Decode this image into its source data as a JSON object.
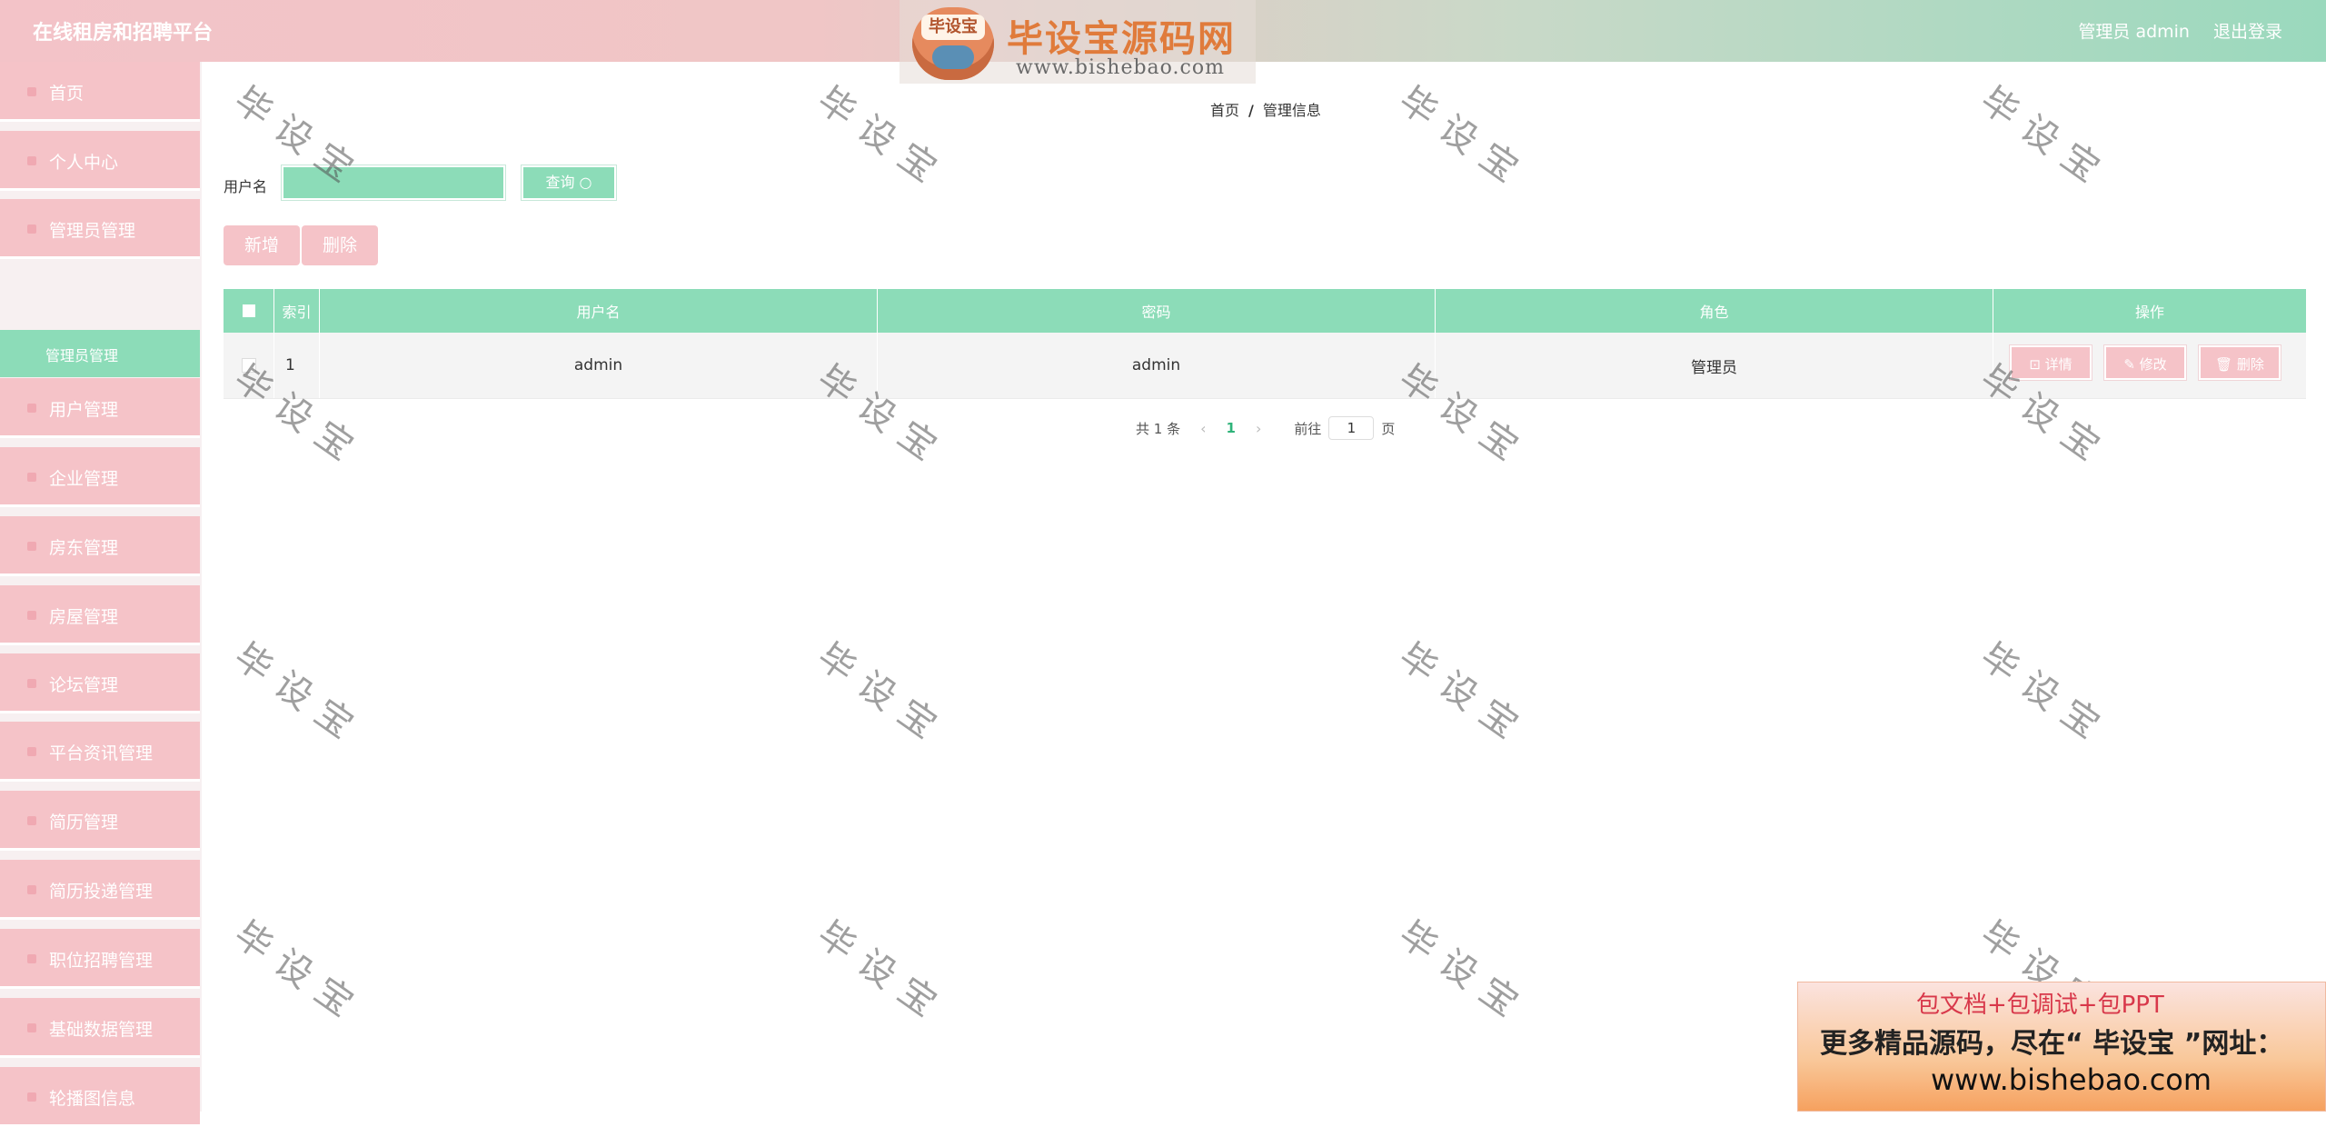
{
  "header": {
    "app_title": "在线租房和招聘平台",
    "user_label": "管理员 admin",
    "logout_label": "退出登录"
  },
  "logo": {
    "badge_text": "毕设宝",
    "main_text": "毕设宝源码网",
    "url_text": "www.bishebao.com"
  },
  "sidebar": {
    "items": [
      {
        "label": "首页"
      },
      {
        "label": "个人中心"
      },
      {
        "label": "管理员管理"
      },
      {
        "label": "用户管理"
      },
      {
        "label": "企业管理"
      },
      {
        "label": "房东管理"
      },
      {
        "label": "房屋管理"
      },
      {
        "label": "论坛管理"
      },
      {
        "label": "平台资讯管理"
      },
      {
        "label": "简历管理"
      },
      {
        "label": "简历投递管理"
      },
      {
        "label": "职位招聘管理"
      },
      {
        "label": "基础数据管理"
      },
      {
        "label": "轮播图信息"
      }
    ],
    "active_submenu": "管理员管理"
  },
  "breadcrumb": {
    "home": "首页",
    "separator": "/",
    "current": "管理信息"
  },
  "search": {
    "label": "用户名",
    "value": "",
    "query_button": "查询 ○"
  },
  "actions": {
    "add": "新增",
    "delete": "删除"
  },
  "table": {
    "columns": [
      "索引",
      "用户名",
      "密码",
      "角色",
      "操作"
    ],
    "rows": [
      {
        "index": "1",
        "username": "admin",
        "password": "admin",
        "role": "管理员"
      }
    ],
    "row_actions": {
      "detail": "⊡ 详情",
      "edit": "✎ 修改",
      "delete": "🗑 删除"
    }
  },
  "pagination": {
    "total": "共 1 条",
    "current_page": "1",
    "goto_label": "前往",
    "goto_value": "1",
    "page_suffix": "页"
  },
  "watermark": "毕设宝",
  "ad": {
    "line1": "包文档+包调试+包PPT",
    "line2": "更多精品源码，尽在“ 毕设宝 ”网址：",
    "line3": "www.bishebao.com"
  },
  "colors": {
    "mint": "#8cdcb8",
    "pink": "#f5c3c8"
  }
}
